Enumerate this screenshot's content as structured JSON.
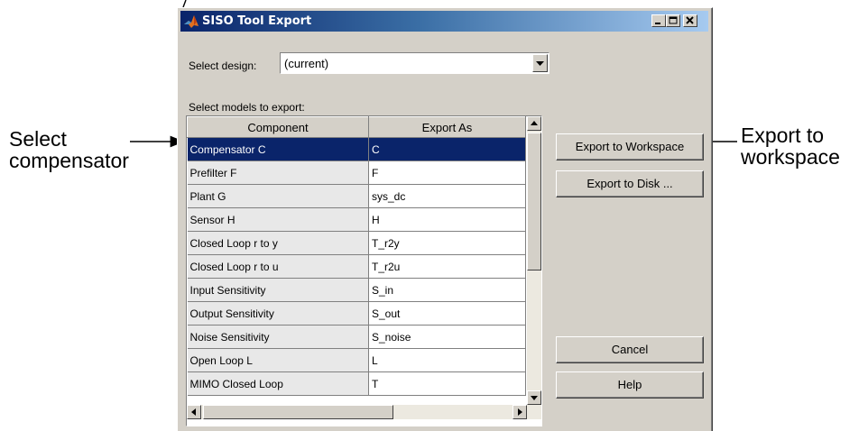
{
  "annotations": {
    "left_line1": "Select",
    "left_line2": "compensator",
    "right_line1": "Export to",
    "right_line2": "workspace"
  },
  "window": {
    "title": "SISO Tool Export",
    "app_icon": "matlab-logo-icon",
    "controls": [
      "minimize-icon",
      "maximize-icon",
      "close-icon"
    ]
  },
  "design": {
    "label": "Select design:",
    "value": "(current)"
  },
  "models": {
    "label": "Select models to export:",
    "columns": [
      "Component",
      "Export As"
    ],
    "rows": [
      {
        "component": "Compensator C",
        "export_as": "C",
        "selected": true
      },
      {
        "component": "Prefilter F",
        "export_as": "F"
      },
      {
        "component": "Plant G",
        "export_as": "sys_dc"
      },
      {
        "component": "Sensor H",
        "export_as": "H"
      },
      {
        "component": "Closed Loop r to y",
        "export_as": "T_r2y"
      },
      {
        "component": "Closed Loop r to u",
        "export_as": "T_r2u"
      },
      {
        "component": "Input Sensitivity",
        "export_as": "S_in"
      },
      {
        "component": "Output Sensitivity",
        "export_as": "S_out"
      },
      {
        "component": "Noise Sensitivity",
        "export_as": "S_noise"
      },
      {
        "component": "Open Loop L",
        "export_as": "L"
      },
      {
        "component": "MIMO Closed Loop",
        "export_as": "T"
      }
    ]
  },
  "buttons": {
    "export_workspace": "Export to Workspace",
    "export_disk": "Export to Disk ...",
    "cancel": "Cancel",
    "help": "Help"
  },
  "colors": {
    "title_bar": "#0a246a",
    "selection": "#0a246a",
    "dialog_face": "#d4d0c8"
  }
}
